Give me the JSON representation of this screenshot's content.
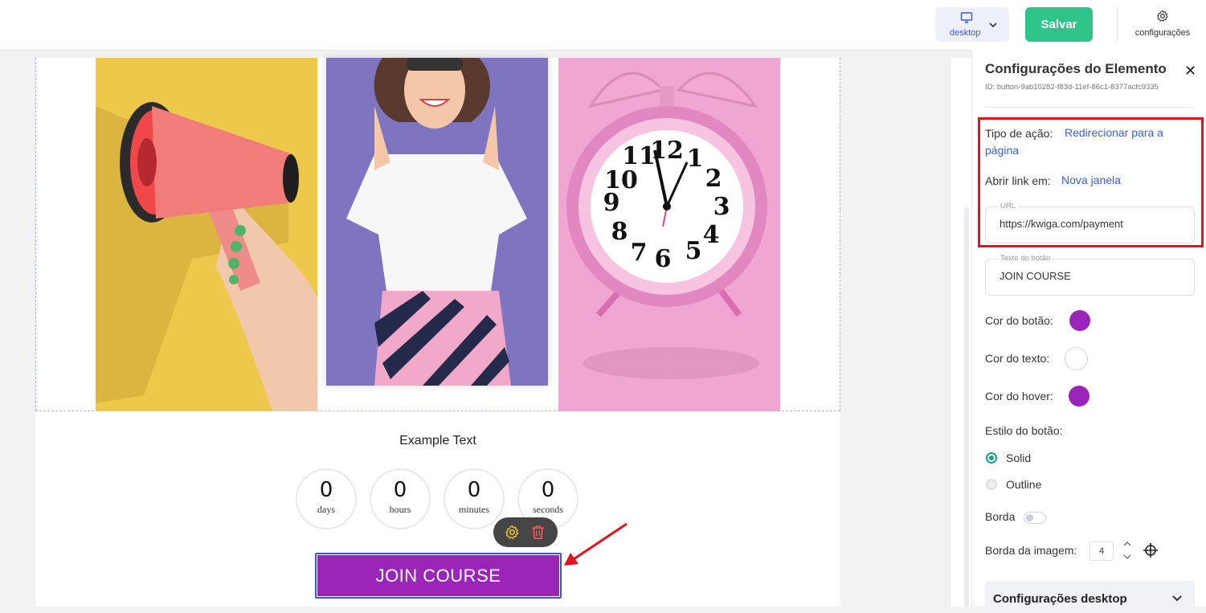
{
  "topbar": {
    "device_label": "desktop",
    "save_label": "Salvar",
    "settings_label": "configurações"
  },
  "canvas": {
    "example_text": "Example Text",
    "countdown": [
      {
        "value": "0",
        "label": "days"
      },
      {
        "value": "0",
        "label": "hours"
      },
      {
        "value": "0",
        "label": "minutes"
      },
      {
        "value": "0",
        "label": "seconds"
      }
    ],
    "button_label": "JOIN COURSE"
  },
  "sidebar": {
    "title": "Configurações do Elemento",
    "element_id": "ID: button-9ab10282-f83d-11ef-86c1-8377acfc9335",
    "action_type_label": "Tipo de ação:",
    "action_type_value": "Redirecionar para a página",
    "open_link_label": "Abrir link em:",
    "open_link_value": "Nova janela",
    "url_label": "URL",
    "url_value": "https://kwiga.com/payment",
    "button_text_label": "Texto do botão",
    "button_text_value": "JOIN COURSE",
    "button_color_label": "Cor do botão:",
    "text_color_label": "Cor do texto:",
    "hover_color_label": "Cor do hover:",
    "button_style_label": "Estilo do botão:",
    "style_options": [
      "Solid",
      "Outline"
    ],
    "border_label": "Borda",
    "image_border_label": "Borda da imagem:",
    "image_border_value": "4",
    "desktop_settings_label": "Configurações desktop"
  },
  "colors": {
    "button_color": "#9b25b8",
    "text_color": "#ffffff",
    "hover_color": "#9b25b8",
    "accent": "#2fc58a",
    "link": "#3562d9",
    "highlight": "#e2131e"
  }
}
